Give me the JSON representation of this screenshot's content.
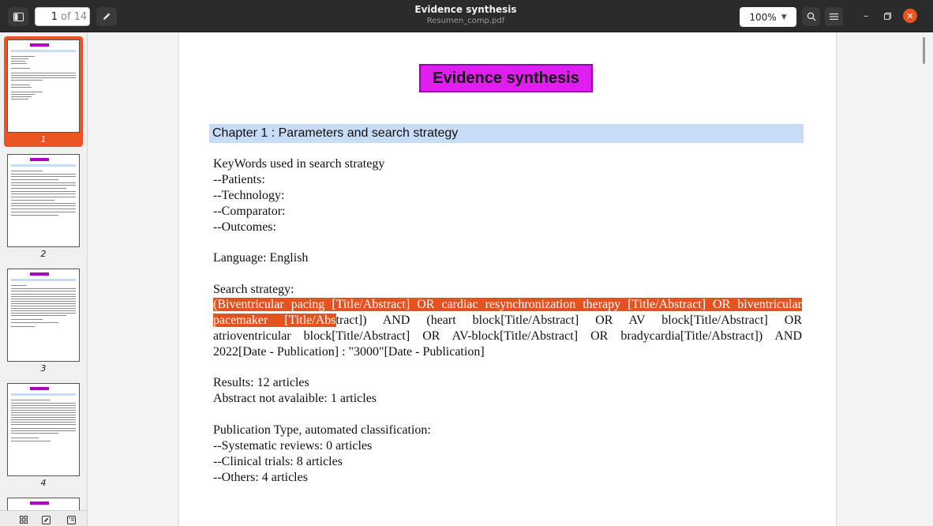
{
  "header": {
    "current_page": "1",
    "page_of": "of 14",
    "title": "Evidence synthesis",
    "subtitle": "Resumen_comp.pdf",
    "zoom": "100%",
    "icons": {
      "sidebar_toggle": "sidebar-icon",
      "annotate": "pencil-icon",
      "search": "search-icon",
      "menu": "hamburger-menu-icon",
      "minimize": "minimize-icon",
      "maximize": "maximize-icon",
      "close": "close-icon"
    },
    "accent_color": "#e95420"
  },
  "sidebar": {
    "thumbnails": [
      {
        "label": "1",
        "selected": true
      },
      {
        "label": "2",
        "selected": false
      },
      {
        "label": "3",
        "selected": false
      },
      {
        "label": "4",
        "selected": false
      }
    ],
    "footer_icons": [
      "thumbnails-icon",
      "annotations-icon",
      "outline-icon"
    ]
  },
  "document": {
    "heading": "Evidence synthesis",
    "chapter": "Chapter 1 : Parameters and search strategy",
    "keywords_title": "KeyWords used in search strategy",
    "keywords": [
      "--Patients:",
      "--Technology:",
      "--Comparator:",
      "--Outcomes:"
    ],
    "language": "Language: English",
    "search_title": "Search strategy:",
    "search_highlighted_1": " (Biventricular pacing [Title/Abstract] OR cardiac resynchronization therapy [Title/Abstract] OR biventricular",
    "search_highlighted_2": "pacemaker  [Title/Abs",
    "search_rest_1": "tract])  AND  (heart  block[Title/Abstract]  OR  AV  block[Title/Abstract]  OR",
    "search_rest_2": "atrioventricular block[Title/Abstract] OR AV-block[Title/Abstract] OR bradycardia[Title/Abstract]) AND",
    "search_rest_3": "2022[Date - Publication] : \"3000\"[Date - Publication]",
    "results": "Results: 12 articles",
    "abstract_na": "Abstract not avalaible: 1 articles",
    "pubtype_title": "Publication Type, automated classification:",
    "pubtypes": [
      "--Systematic reviews: 0 articles",
      "--Clinical trials: 8 articles",
      "--Others: 4 articles"
    ],
    "heading_color": "#e11ef0",
    "chapter_band_color": "#c9dcf7",
    "highlight_color": "#e2531f"
  }
}
